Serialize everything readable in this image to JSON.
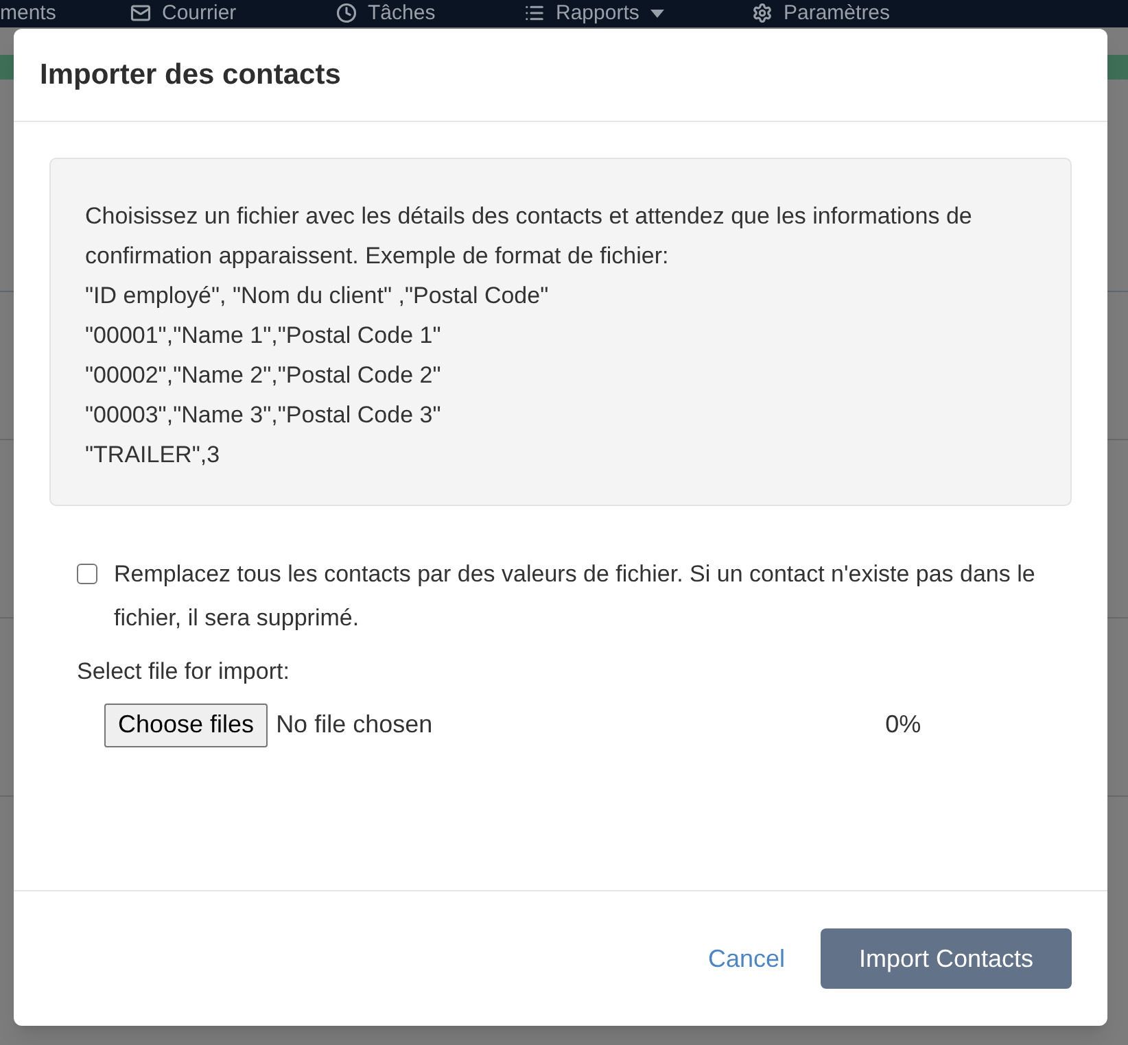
{
  "nav": {
    "items": [
      {
        "label": "ments",
        "dropdown": false
      },
      {
        "label": "Courrier",
        "dropdown": false
      },
      {
        "label": "Tâches",
        "dropdown": false
      },
      {
        "label": "Rapports",
        "dropdown": true
      },
      {
        "label": "Paramètres",
        "dropdown": false
      }
    ]
  },
  "dialog": {
    "title": "Importer des contacts",
    "info": {
      "description": "Choisissez un fichier avec les détails des contacts et attendez que les informations de confirmation apparaissent. Exemple de format de fichier:",
      "example_lines": [
        "\"ID employé\", \"Nom du client\" ,\"Postal Code\"",
        "\"00001\",\"Name 1\",\"Postal Code 1\"",
        "\"00002\",\"Name 2\",\"Postal Code 2\"",
        "\"00003\",\"Name 3\",\"Postal Code 3\"",
        "\"TRAILER\",3"
      ]
    },
    "replace_option": {
      "label": "Remplacez tous les contacts par des valeurs de fichier. Si un contact n'existe pas dans le fichier, il sera supprimé.",
      "checked": false
    },
    "file_input": {
      "label": "Select file for import:",
      "button": "Choose files",
      "status": "No file chosen",
      "progress": "0%"
    },
    "buttons": [
      {
        "label": "Cancel",
        "kind": "link"
      },
      {
        "label": "Import Contacts",
        "kind": "primary"
      }
    ]
  }
}
